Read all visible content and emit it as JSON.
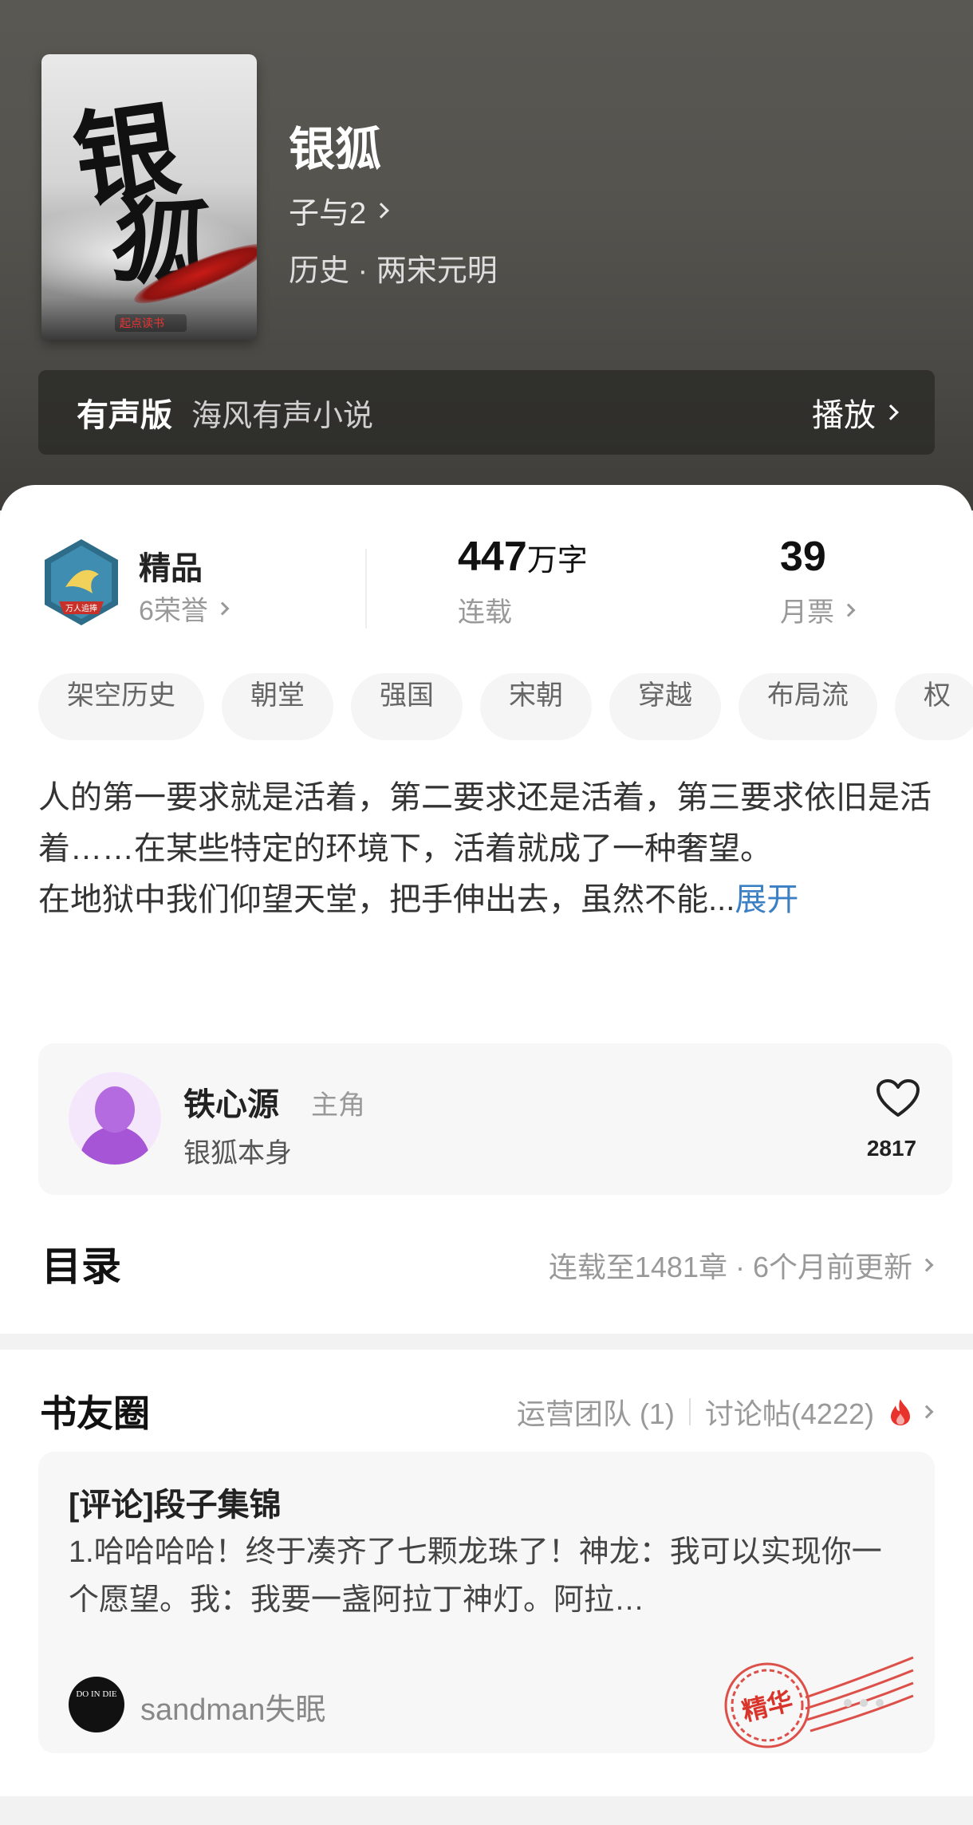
{
  "book": {
    "title": "银狐",
    "author": "子与2",
    "genre": "历史 · 两宋元明",
    "cover_glyph_1": "银",
    "cover_glyph_2": "狐",
    "cover_publisher": "起点读书"
  },
  "audio": {
    "label": "有声版",
    "source": "海风有声小说",
    "play_label": "播放"
  },
  "stats": {
    "honor_title": "精品",
    "honor_count": "6荣誉",
    "badge_text": "万人追捧",
    "word_count": "447",
    "word_unit": "万字",
    "word_status": "连载",
    "monthly_votes": "39",
    "votes_label": "月票"
  },
  "tags": [
    "架空历史",
    "朝堂",
    "强国",
    "宋朝",
    "穿越",
    "布局流",
    "权"
  ],
  "intro": {
    "line1": "人的第一要求就是活着，第二要求还是活着，第三要求依旧是活着……在某些特定的环境下，活着就成了一种奢望。",
    "line2": "在地狱中我们仰望天堂，把手伸出去，虽然不能...",
    "expand": "展开"
  },
  "character": {
    "name": "铁心源",
    "role": "主角",
    "description": "银狐本身",
    "likes": "2817"
  },
  "toc": {
    "title": "目录",
    "status": "连载至1481章 · 6个月前更新"
  },
  "forum": {
    "title": "书友圈",
    "ops_team": "运营团队 (1)",
    "discussions": "讨论帖(4222)",
    "post_title": "[评论]段子集锦",
    "post_body": "1.哈哈哈哈！终于凑齐了七颗龙珠了！神龙：我可以实现你一个愿望。我：我要一盏阿拉丁神灯。阿拉…",
    "post_user": "sandman失眠",
    "avatar_text": "DO IN DIE",
    "stamp_text": "精华"
  },
  "colors": {
    "accent_link": "#3b7fc4",
    "hot_flame": "#e8332c",
    "stamp_red": "#d9342b"
  }
}
